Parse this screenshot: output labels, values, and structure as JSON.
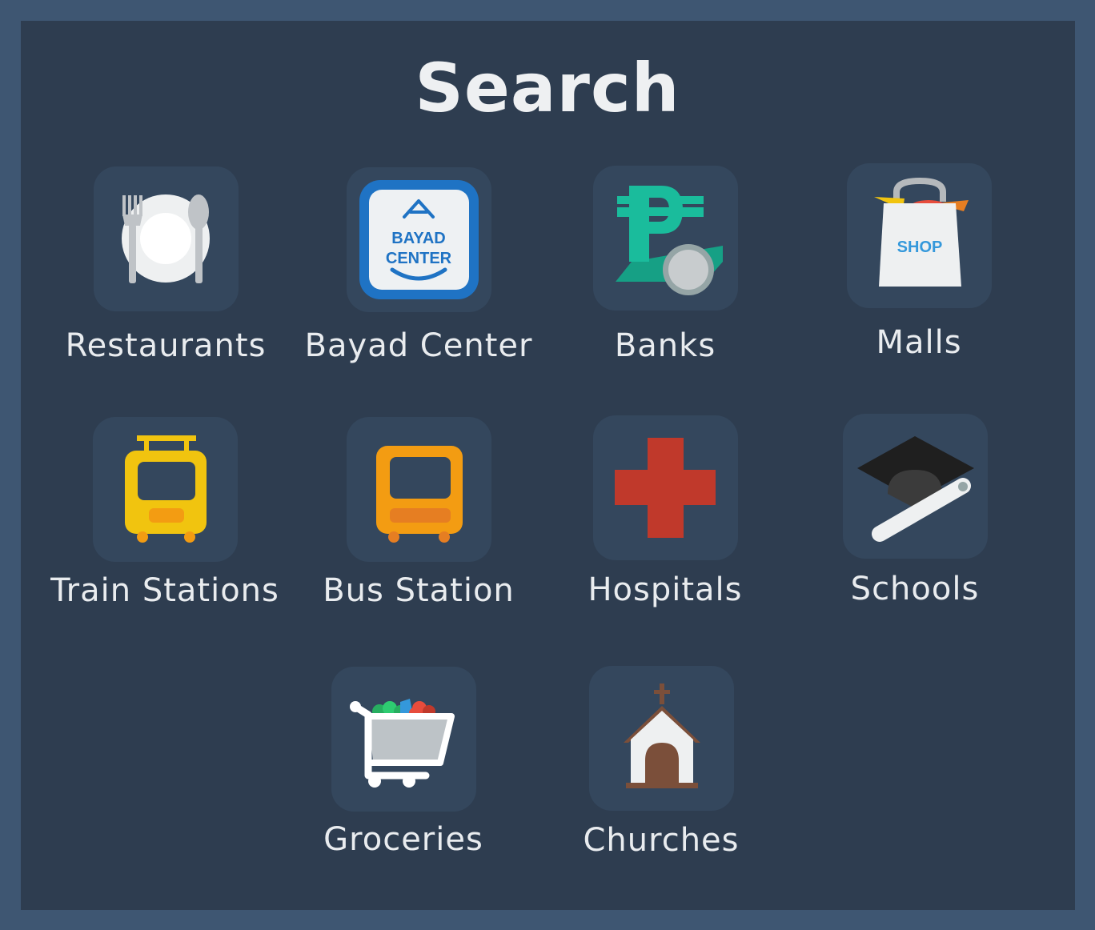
{
  "header": {
    "title": "Search"
  },
  "categories": {
    "restaurants": {
      "label": "Restaurants",
      "icon": "fork-plate-spoon-icon"
    },
    "bayad_center": {
      "label": "Bayad Center",
      "icon": "bayad-center-logo",
      "logo_text": [
        "BAYAD",
        "CENTER"
      ]
    },
    "banks": {
      "label": "Banks",
      "icon": "peso-coin-icon"
    },
    "malls": {
      "label": "Malls",
      "icon": "shopping-bag-icon",
      "bag_text": "SHOP"
    },
    "train_stations": {
      "label": "Train Stations",
      "icon": "train-icon"
    },
    "bus_station": {
      "label": "Bus Station",
      "icon": "bus-icon"
    },
    "hospitals": {
      "label": "Hospitals",
      "icon": "red-cross-icon"
    },
    "schools": {
      "label": "Schools",
      "icon": "graduation-cap-icon"
    },
    "groceries": {
      "label": "Groceries",
      "icon": "shopping-cart-icon"
    },
    "churches": {
      "label": "Churches",
      "icon": "church-icon"
    }
  },
  "colors": {
    "outer_border": "#3e5672",
    "panel": "#2e3d50",
    "tile": "#34475d",
    "text": "#e9ecef"
  }
}
